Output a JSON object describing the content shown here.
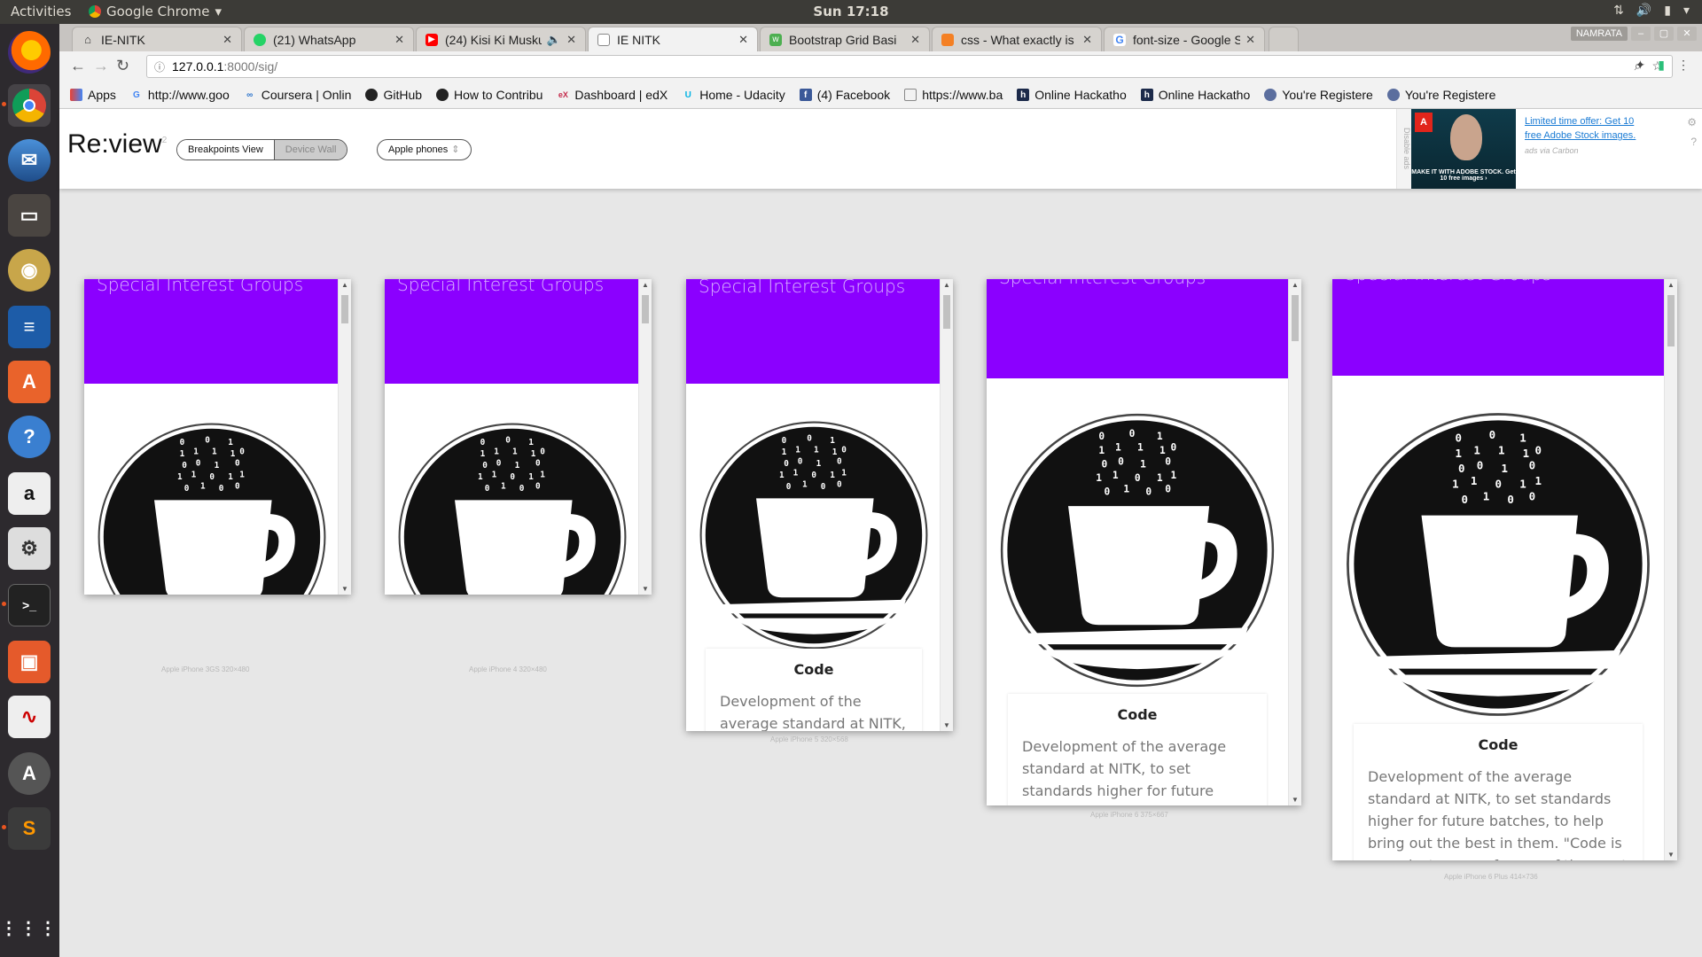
{
  "topbar": {
    "activities": "Activities",
    "app_name": "Google Chrome",
    "clock": "Sun 17:18"
  },
  "browser": {
    "tabs": [
      {
        "title": "IE-NITK",
        "color": "#333"
      },
      {
        "title": "(21) WhatsApp",
        "color": "#25d366"
      },
      {
        "title": "(24) Kisi Ki Musku",
        "color": "#ff0000"
      },
      {
        "title": "IE NITK",
        "color": "#888"
      },
      {
        "title": "Bootstrap Grid Basi",
        "color": "#4caf50"
      },
      {
        "title": "css - What exactly is",
        "color": "#f48024"
      },
      {
        "title": "font-size - Google S",
        "color": "#4285f4"
      }
    ],
    "user": "NAMRATA",
    "url_host": "127.0.0.1",
    "url_path": ":8000/sig/",
    "bookmarks": [
      {
        "label": "Apps",
        "color": "#e94235"
      },
      {
        "label": "http://www.goo",
        "color": "#4285f4"
      },
      {
        "label": "Coursera | Onlin",
        "color": "#2a73cc"
      },
      {
        "label": "GitHub",
        "color": "#222"
      },
      {
        "label": "How to Contribu",
        "color": "#222"
      },
      {
        "label": "Dashboard | edX",
        "color": "#c4294a"
      },
      {
        "label": "Home - Udacity",
        "color": "#02b3e4"
      },
      {
        "label": "(4) Facebook",
        "color": "#3b5998"
      },
      {
        "label": "https://www.ba",
        "color": "#999"
      },
      {
        "label": "Online Hackatho",
        "color": "#1c2a4a"
      },
      {
        "label": "Online Hackatho",
        "color": "#1c2a4a"
      },
      {
        "label": "You're Registere",
        "color": "#5b6e9e"
      },
      {
        "label": "You're Registere",
        "color": "#5b6e9e"
      }
    ]
  },
  "review": {
    "logo": "Re:view",
    "logo_sup": "2",
    "view_toggle": {
      "active": "Breakpoints View",
      "inactive": "Device Wall"
    },
    "device_filter": "Apple phones",
    "ad": {
      "side_label": "Disable ads",
      "link_text": "Limited time offer: Get 10 free Adobe Stock images.",
      "via": "ads via Carbon",
      "image_caption": "MAKE IT WITH ADOBE STOCK. Get 10 free images ›"
    }
  },
  "site": {
    "hero_title": "Special Interest Groups",
    "card_title": "Code",
    "card_text": "Development of the average standard at NITK, to set standards higher for future batches, to help bring out the best in them. \"Code is a modest group of some of the most"
  },
  "devices": [
    {
      "label": "Apple iPhone 3GS   320×480"
    },
    {
      "label": "Apple iPhone 4   320×480"
    },
    {
      "label": "Apple iPhone 5   320×568"
    },
    {
      "label": "Apple iPhone 6   375×667"
    },
    {
      "label": "Apple iPhone 6 Plus   414×736"
    }
  ],
  "colors": {
    "hero": "#8b00ff",
    "accent": "#1a7bd4"
  }
}
